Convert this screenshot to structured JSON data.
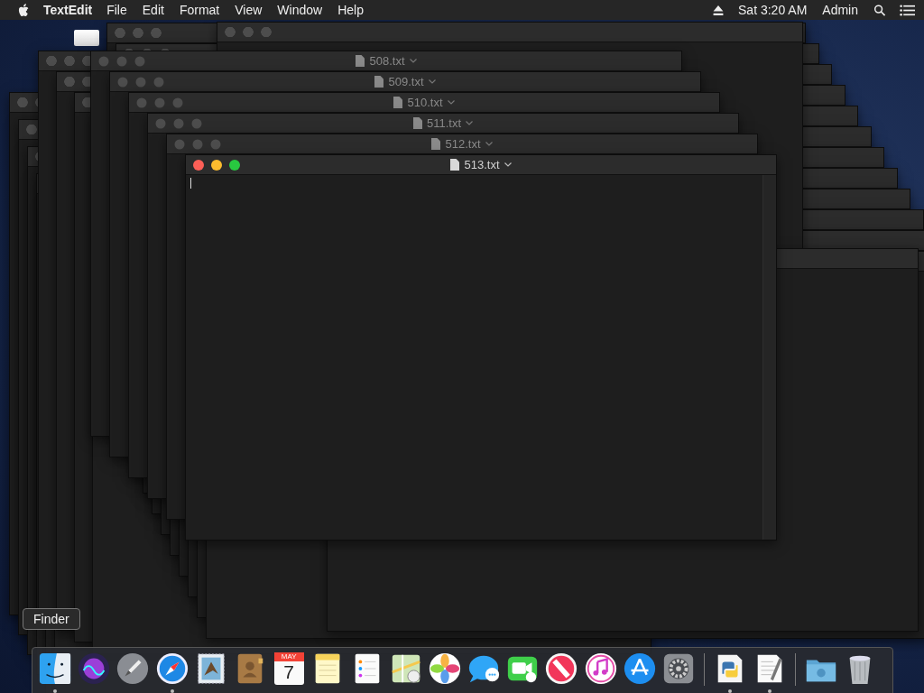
{
  "menu_bar": {
    "app_name": "TextEdit",
    "menus": [
      "File",
      "Edit",
      "Format",
      "View",
      "Window",
      "Help"
    ],
    "clock": "Sat 3:20 AM",
    "user": "Admin"
  },
  "windows": [
    {
      "title": "508.txt",
      "active": false
    },
    {
      "title": "509.txt",
      "active": false
    },
    {
      "title": "510.txt",
      "active": false
    },
    {
      "title": "511.txt",
      "active": false
    },
    {
      "title": "512.txt",
      "active": false
    },
    {
      "title": "513.txt",
      "active": true
    }
  ],
  "tooltip": "Finder",
  "dock": {
    "items": [
      {
        "kind": "finder",
        "running": true
      },
      {
        "kind": "siri",
        "running": false
      },
      {
        "kind": "launchpad",
        "running": false
      },
      {
        "kind": "safari",
        "running": true
      },
      {
        "kind": "mail",
        "running": false
      },
      {
        "kind": "contacts",
        "running": false
      },
      {
        "kind": "calendar",
        "running": false,
        "month": "MAY",
        "day": "7"
      },
      {
        "kind": "notes",
        "running": false
      },
      {
        "kind": "reminders",
        "running": false
      },
      {
        "kind": "maps",
        "running": false
      },
      {
        "kind": "photos",
        "running": false
      },
      {
        "kind": "messages",
        "running": false
      },
      {
        "kind": "facetime",
        "running": false
      },
      {
        "kind": "news",
        "running": false
      },
      {
        "kind": "music",
        "running": false
      },
      {
        "kind": "appstore",
        "running": false
      },
      {
        "kind": "preferences",
        "running": false
      },
      {
        "kind": "separator"
      },
      {
        "kind": "python",
        "running": true
      },
      {
        "kind": "textedit",
        "running": true
      },
      {
        "kind": "separator"
      },
      {
        "kind": "folder",
        "running": false
      },
      {
        "kind": "trash",
        "running": false
      }
    ]
  }
}
